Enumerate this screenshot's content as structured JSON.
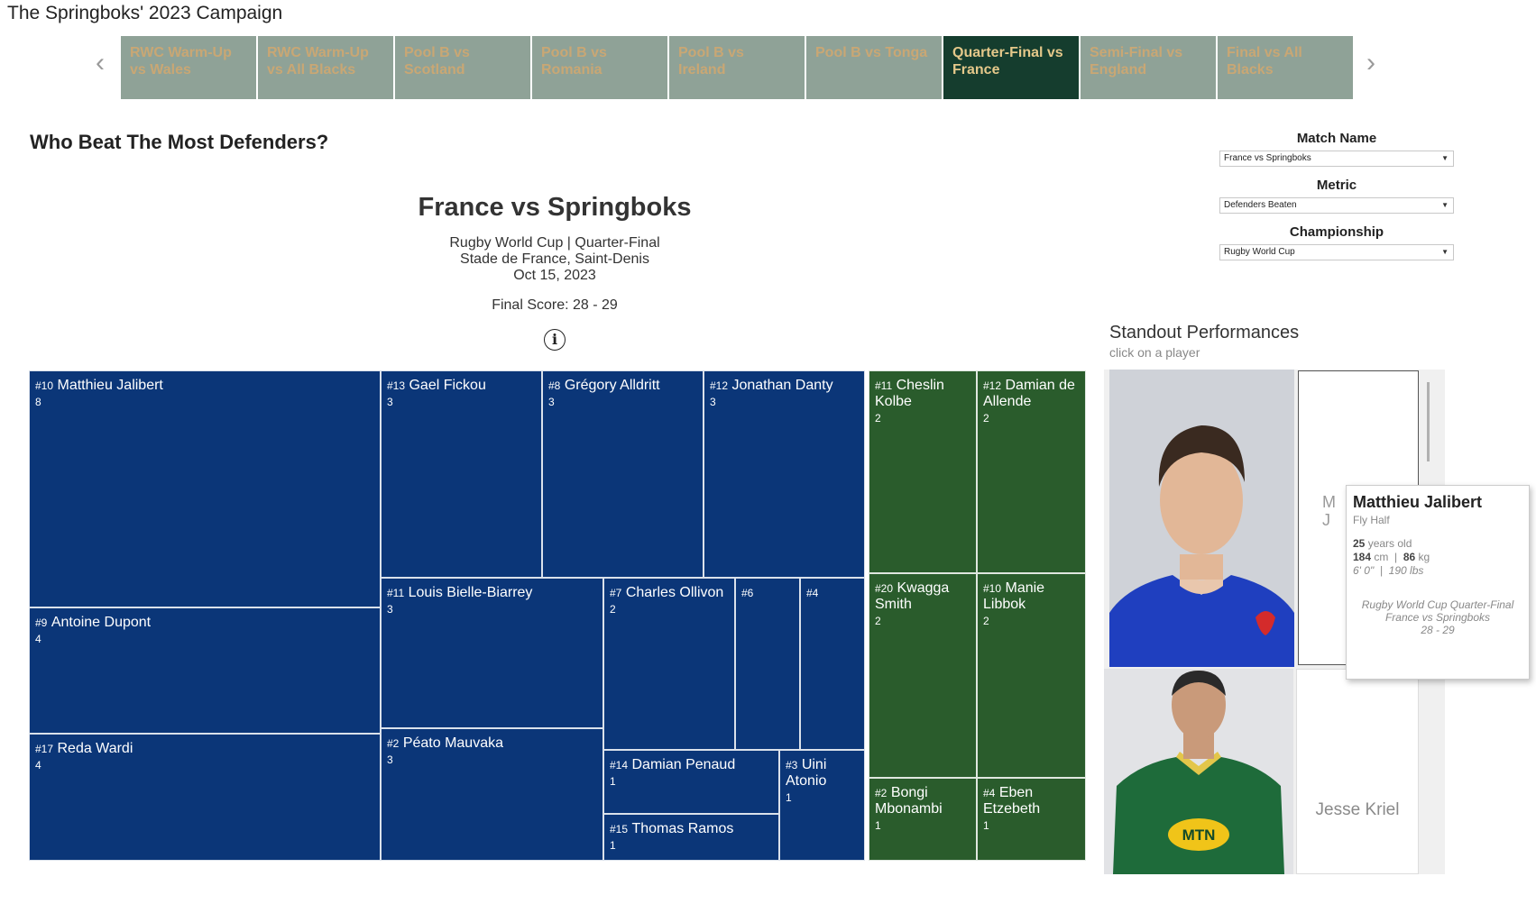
{
  "page": {
    "title": "The Springboks' 2023 Campaign"
  },
  "tabs": [
    {
      "line1": "RWC Warm-Up",
      "line2": "vs Wales",
      "active": false
    },
    {
      "line1": "RWC Warm-Up",
      "line2": "vs All Blacks",
      "active": false
    },
    {
      "line1": "Pool B vs",
      "line2": "Scotland",
      "active": false
    },
    {
      "line1": "Pool B vs",
      "line2": "Romania",
      "active": false
    },
    {
      "line1": "Pool B vs",
      "line2": "Ireland",
      "active": false
    },
    {
      "line1": "Pool B vs Tonga",
      "line2": "",
      "active": false
    },
    {
      "line1": "Quarter-Final vs",
      "line2": "France",
      "active": true
    },
    {
      "line1": "Semi-Final vs",
      "line2": "England",
      "active": false
    },
    {
      "line1": "Final vs All",
      "line2": "Blacks",
      "active": false
    }
  ],
  "nav": {
    "prev_icon": "chevron-left-icon",
    "next_icon": "chevron-right-icon"
  },
  "section": {
    "title": "Who Beat The Most Defenders?"
  },
  "match": {
    "title": "France vs Springboks",
    "competition": "Rugby World Cup | Quarter-Final",
    "venue": "Stade de France, Saint-Denis",
    "date": "Oct 15, 2023",
    "score": "Final Score: 28 - 29",
    "info_glyph": "i"
  },
  "filters": {
    "match_name": {
      "label": "Match Name",
      "value": "France vs Springboks"
    },
    "metric": {
      "label": "Metric",
      "value": "Defenders Beaten"
    },
    "championship": {
      "label": "Championship",
      "value": "Rugby World Cup"
    }
  },
  "colors": {
    "france": "#0b3678",
    "springboks": "#2a5c2c",
    "tab_bg": "#8fa297",
    "tab_active": "#153d2e",
    "tab_text": "#c9a774"
  },
  "treemap": {
    "france": [
      {
        "num": "#10",
        "name": "Matthieu Jalibert",
        "value": "8"
      },
      {
        "num": "#9",
        "name": "Antoine Dupont",
        "value": "4"
      },
      {
        "num": "#17",
        "name": "Reda Wardi",
        "value": "4"
      },
      {
        "num": "#13",
        "name": "Gael Fickou",
        "value": "3"
      },
      {
        "num": "#8",
        "name": "Grégory Alldritt",
        "value": "3"
      },
      {
        "num": "#12",
        "name": "Jonathan Danty",
        "value": "3"
      },
      {
        "num": "#11",
        "name": "Louis Bielle-Biarrey",
        "value": "3"
      },
      {
        "num": "#7",
        "name": "Charles Ollivon",
        "value": "2"
      },
      {
        "num": "#6",
        "name": "",
        "value": ""
      },
      {
        "num": "#4",
        "name": "",
        "value": ""
      },
      {
        "num": "#2",
        "name": "Péato Mauvaka",
        "value": "3"
      },
      {
        "num": "#14",
        "name": "Damian Penaud",
        "value": "1"
      },
      {
        "num": "#3",
        "name": "Uini Atonio",
        "value": "1"
      },
      {
        "num": "#15",
        "name": "Thomas Ramos",
        "value": "1"
      }
    ],
    "springboks": [
      {
        "num": "#11",
        "name": "Cheslin Kolbe",
        "value": "2"
      },
      {
        "num": "#12",
        "name": "Damian de Allende",
        "value": "2"
      },
      {
        "num": "#20",
        "name": "Kwagga Smith",
        "value": "2"
      },
      {
        "num": "#10",
        "name": "Manie Libbok",
        "value": "2"
      },
      {
        "num": "#2",
        "name": "Bongi Mbonambi",
        "value": "1"
      },
      {
        "num": "#4",
        "name": "Eben Etzebeth",
        "value": "1"
      }
    ]
  },
  "standout": {
    "title": "Standout Performances",
    "subtitle": "click on a player",
    "card1_partial": "M\nJ",
    "card2_name": "Jesse Kriel",
    "photo1_alt": "Matthieu Jalibert photo",
    "photo2_alt": "Springboks player photo",
    "jersey_sponsor": "MTN"
  },
  "tooltip": {
    "name": "Matthieu Jalibert",
    "position": "Fly Half",
    "age": "25",
    "age_unit": "years old",
    "height_cm": "184",
    "cm_unit": "cm",
    "weight_kg": "86",
    "kg_unit": "kg",
    "sep": "|",
    "imperial": "6' 0\"  |  190 lbs",
    "comp": "Rugby World Cup Quarter-Final",
    "match": "France vs Springboks",
    "score": "28 - 29"
  }
}
